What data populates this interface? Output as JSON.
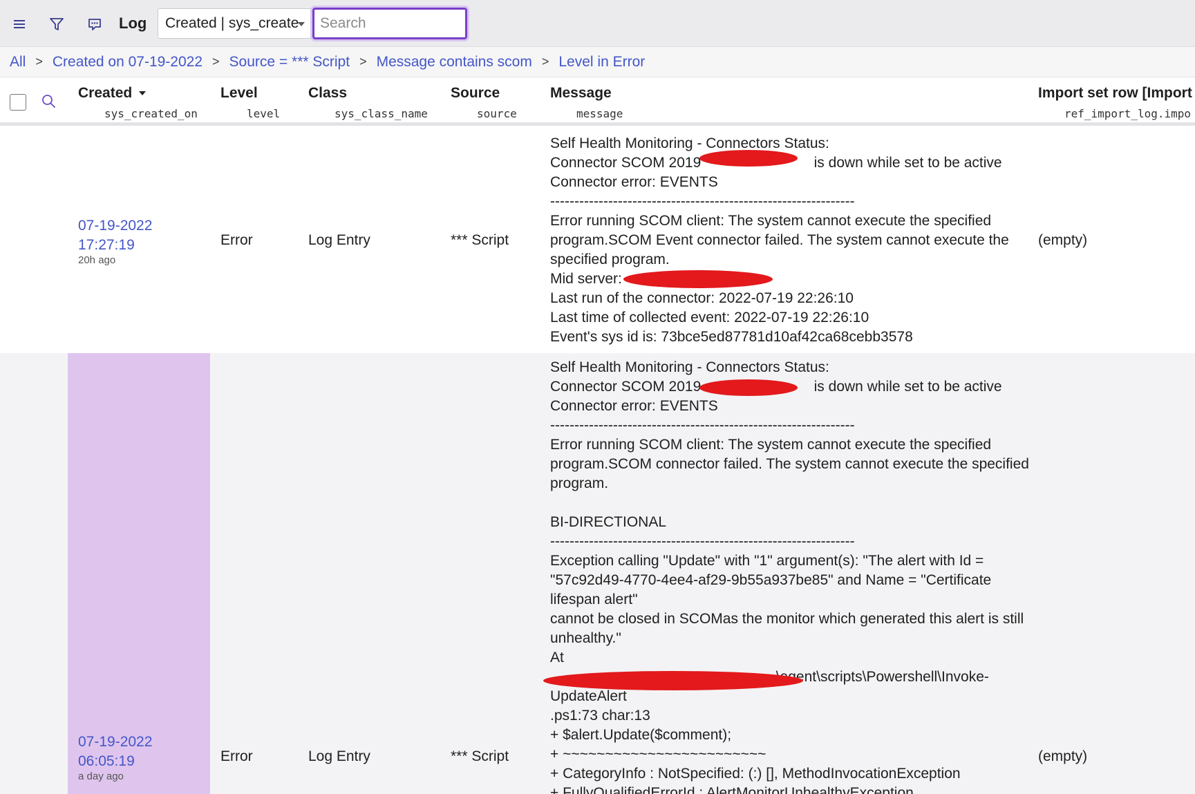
{
  "toolbar": {
    "title": "Log",
    "field_select": "Created | sys_create",
    "search_placeholder": "Search",
    "icons": [
      "menu-icon",
      "filter-icon",
      "chat-icon"
    ]
  },
  "breadcrumb": {
    "items": [
      "All",
      "Created on 07-19-2022",
      "Source = *** Script",
      "Message contains scom",
      "Level in Error"
    ],
    "separator": ">"
  },
  "columns": [
    {
      "label": "Created",
      "field": "sys_created_on",
      "sorted": "desc"
    },
    {
      "label": "Level",
      "field": "level"
    },
    {
      "label": "Class",
      "field": "sys_class_name"
    },
    {
      "label": "Source",
      "field": "source"
    },
    {
      "label": "Message",
      "field": "message"
    },
    {
      "label": "Import set row [Import L",
      "field": "ref_import_log.impo"
    }
  ],
  "rows": [
    {
      "created_date": "07-19-2022",
      "created_time": "17:27:19",
      "created_ago": "20h ago",
      "level": "Error",
      "class": "Log Entry",
      "source": "*** Script",
      "message_lines": [
        "Self Health Monitoring - Connectors Status:",
        "Connector SCOM 2019                            is down while set to be active",
        "Connector error: EVENTS",
        "---------------------------------------------------------------",
        "Error running SCOM client: The system cannot execute the specified",
        "program.SCOM Event connector failed. The system cannot execute the",
        "specified program.",
        "Mid server:",
        "Last run of the connector: 2022-07-19 22:26:10",
        "Last time of collected event: 2022-07-19 22:26:10",
        "Event's sys id is: 73bce5ed87781d10af42ca68cebb3578"
      ],
      "import_set_row": "(empty)"
    },
    {
      "created_date": "07-19-2022",
      "created_time": "06:05:19",
      "created_ago": "a day ago",
      "level": "Error",
      "class": "Log Entry",
      "source": "*** Script",
      "message_lines": [
        "Self Health Monitoring - Connectors Status:",
        "Connector SCOM 2019                            is down while set to be active",
        "Connector error: EVENTS",
        "---------------------------------------------------------------",
        "Error running SCOM client: The system cannot execute the specified",
        "program.SCOM connector failed. The system cannot execute the specified",
        "program.",
        "",
        "BI-DIRECTIONAL",
        "---------------------------------------------------------------",
        "Exception calling \"Update\" with \"1\" argument(s): \"The alert with Id =",
        "\"57c92d49-4770-4ee4-af29-9b55a937be85\" and Name = \"Certificate",
        "lifespan alert\"",
        "cannot be closed in SCOMas the monitor which generated this alert is still",
        "unhealthy.\"",
        "At",
        "                                                        \\agent\\scripts\\Powershell\\Invoke-",
        "UpdateAlert",
        ".ps1:73 char:13",
        "+ $alert.Update($comment);",
        "+ ~~~~~~~~~~~~~~~~~~~~~~~~",
        "+ CategoryInfo : NotSpecified: (:) [], MethodInvocationException",
        "+ FullyQualifiedErrorId : AlertMonitorUnhealthyException"
      ],
      "import_set_row": "(empty)"
    }
  ],
  "colors": {
    "link": "#4456c7",
    "selection": "#dfc5ee",
    "search_border": "#7a3fc8",
    "redaction": "#e3191c"
  }
}
